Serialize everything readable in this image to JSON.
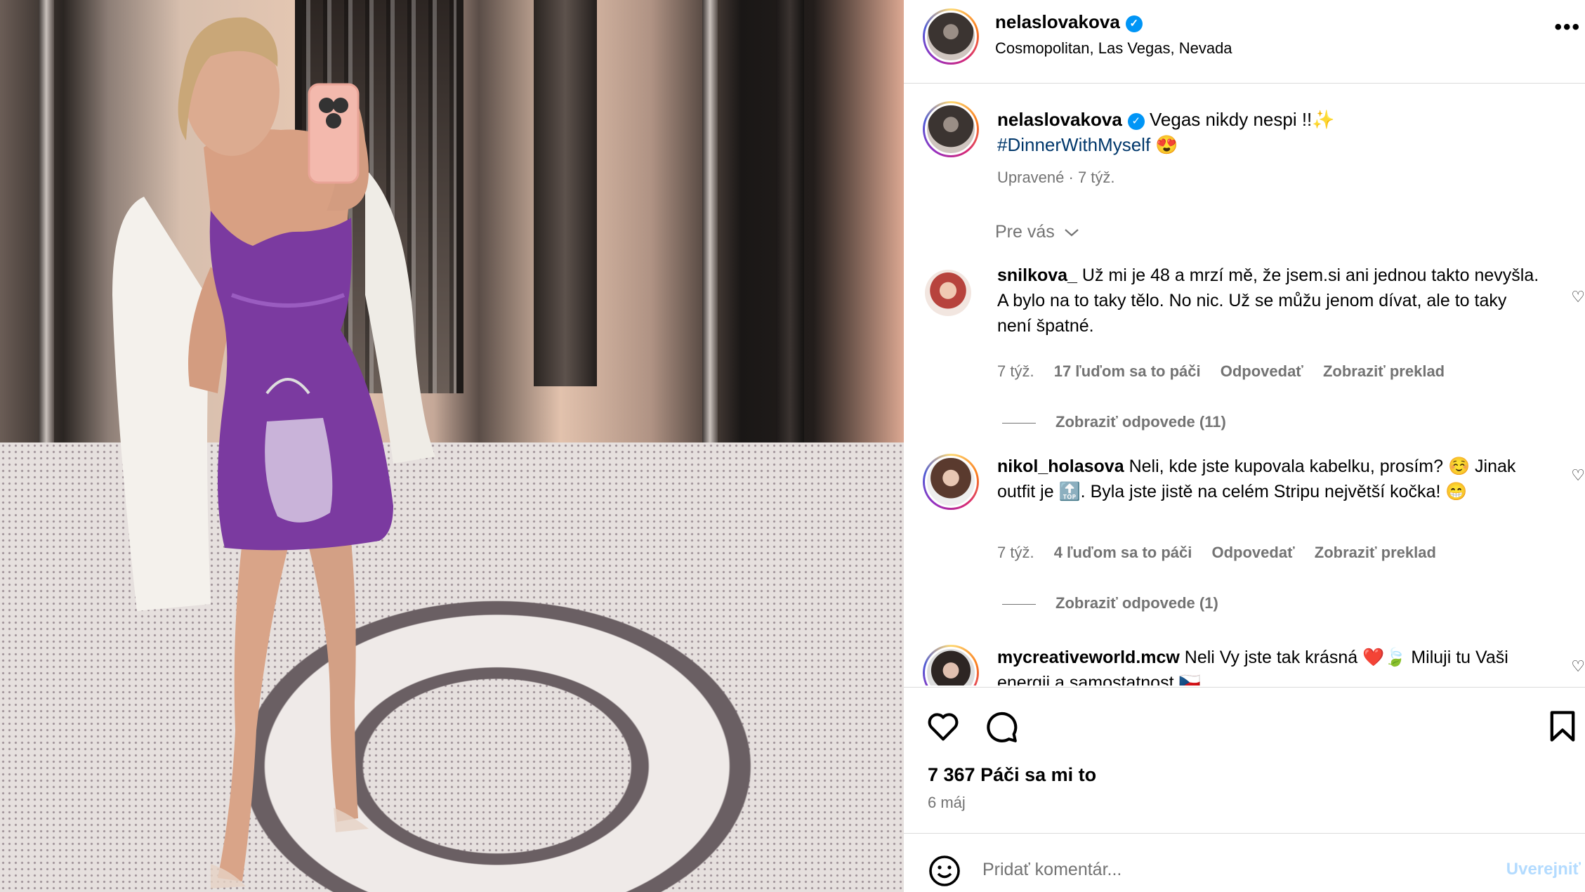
{
  "post": {
    "username": "nelaslovakova",
    "location": "Cosmopolitan, Las Vegas, Nevada",
    "caption_text": "Vegas nikdy nespi !!✨",
    "hashtag": "#DinnerWithMyself",
    "hashtag_emoji": "😍",
    "edited": "Upravené · 7 týž.",
    "for_you": "Pre vás",
    "likes": "7 367 Páči sa mi to",
    "date": "6 máj"
  },
  "comments": [
    {
      "username": "snilkova_",
      "text": "Už mi je 48 a mrzí mě, že jsem.si ani jednou takto nevyšla. A bylo na to taky tělo. No nic. Už se můžu jenom dívat, ale to taky není špatné.",
      "time": "7 týž.",
      "likes": "17 ľuďom sa to páči",
      "reply": "Odpovedať",
      "translate": "Zobraziť preklad",
      "view_replies": "Zobraziť odpovede (11)"
    },
    {
      "username": "nikol_holasova",
      "text": "Neli, kde jste kupovala kabelku, prosím? ☺️ Jinak outfit je 🔝. Byla jste jistě na celém Stripu největší kočka! 😁",
      "time": "7 týž.",
      "likes": "4 ľuďom sa to páči",
      "reply": "Odpovedať",
      "translate": "Zobraziť preklad",
      "view_replies": "Zobraziť odpovede (1)"
    },
    {
      "username": "mycreativeworld.mcw",
      "text": "Neli Vy jste tak krásná ❤️🍃 Miluji tu Vaši energii a samostatnost 🇨🇿"
    }
  ],
  "add_comment": {
    "placeholder": "Pridať komentár...",
    "post_label": "Uverejniť"
  },
  "icons": {
    "verified": "verified-badge-icon",
    "more": "more-options-icon",
    "heart": "heart-icon",
    "comment": "comment-bubble-icon",
    "bookmark": "bookmark-icon",
    "emoji": "emoji-icon",
    "chevron": "chevron-down-icon"
  },
  "colors": {
    "verified_blue": "#0095f6",
    "hashtag": "#00376b",
    "muted_text": "#737373",
    "post_button_disabled": "#b3dbff",
    "dress_purple": "#7b3aa0"
  }
}
